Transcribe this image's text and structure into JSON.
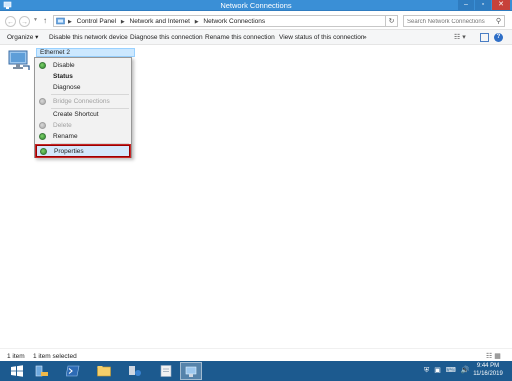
{
  "window": {
    "title": "Network Connections",
    "buttons": {
      "minimize": "–",
      "maximize": "▫",
      "close": "✕"
    }
  },
  "address": {
    "back": "←",
    "forward": "→",
    "up": "↑",
    "separator": "▶",
    "breadcrumbs": [
      "Control Panel",
      "Network and Internet",
      "Network Connections"
    ],
    "refresh": "↻",
    "dropdown": "⌄",
    "search_placeholder": "Search Network Connections",
    "search_icon": "⚲"
  },
  "commands": {
    "organize": "Organize ▾",
    "disable": "Disable this network device",
    "diagnose": "Diagnose this connection",
    "rename": "Rename this connection",
    "view_status": "View status of this connection",
    "more": "»",
    "view_options": "☷ ▾"
  },
  "adapter": {
    "name": "Ethernet 2"
  },
  "context_menu": {
    "items": [
      {
        "label": "Disable",
        "icon": "shield-icon",
        "state": "normal"
      },
      {
        "label": "Status",
        "icon": "",
        "state": "bold"
      },
      {
        "label": "Diagnose",
        "icon": "",
        "state": "normal"
      },
      {
        "label": "Bridge Connections",
        "icon": "shield-icon",
        "state": "disabled"
      },
      {
        "label": "Create Shortcut",
        "icon": "",
        "state": "normal"
      },
      {
        "label": "Delete",
        "icon": "shield-icon",
        "state": "disabled"
      },
      {
        "label": "Rename",
        "icon": "shield-icon",
        "state": "normal"
      },
      {
        "label": "Properties",
        "icon": "shield-icon",
        "state": "highlighted"
      }
    ]
  },
  "status": {
    "item_count": "1 item",
    "selected": "1 item selected",
    "view_icons": "☷ ▦"
  },
  "taskbar": {
    "clock_time": "9:44 PM",
    "clock_date": "11/16/2019",
    "tray": [
      "⛨",
      "▣",
      "⌨",
      "🔊"
    ]
  },
  "colors": {
    "titlebar": "#3a8fd6",
    "taskbar": "#1c5a8f",
    "highlight_border": "#9b0000"
  }
}
